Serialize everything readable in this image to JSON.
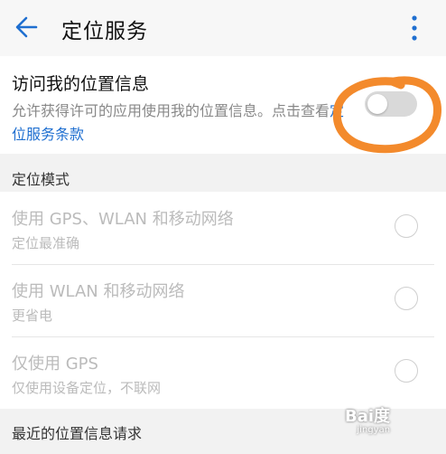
{
  "appbar": {
    "title": "定位服务",
    "back_icon": "arrow-left-icon",
    "more_icon": "more-vertical-icon",
    "accent": "#1f6fd0"
  },
  "location_access": {
    "title": "访问我的位置信息",
    "desc_prefix": "允许获得许可的应用使用我的位置信息。点击查看",
    "desc_link": "定位服务条款",
    "enabled": false
  },
  "mode_section": {
    "header": "定位模式",
    "options": [
      {
        "title": "使用 GPS、WLAN 和移动网络",
        "subtitle": "定位最准确",
        "selected": false
      },
      {
        "title": "使用 WLAN 和移动网络",
        "subtitle": "更省电",
        "selected": false
      },
      {
        "title": "仅使用 GPS",
        "subtitle": "仅使用设备定位，不联网",
        "selected": false
      }
    ]
  },
  "recent_section": {
    "header": "最近的位置信息请求"
  },
  "watermark": {
    "text": "Bai度",
    "sub": "jingyan"
  }
}
